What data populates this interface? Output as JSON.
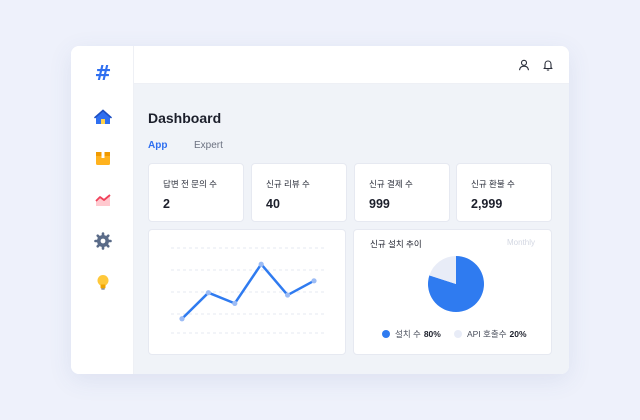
{
  "app": {
    "logo": "#"
  },
  "sidebar": {
    "items": [
      {
        "icon": "home-icon",
        "label": ""
      },
      {
        "icon": "box-icon",
        "label": ""
      },
      {
        "icon": "trend-chart-icon",
        "label": ""
      },
      {
        "icon": "gear-icon",
        "label": ""
      },
      {
        "icon": "lightbulb-icon",
        "label": ""
      }
    ]
  },
  "header": {
    "icons": [
      "user-icon",
      "bell-icon"
    ]
  },
  "main": {
    "title": "Dashboard",
    "tabs": [
      {
        "label": "App",
        "active": true
      },
      {
        "label": "Expert",
        "active": false
      }
    ],
    "stats": [
      {
        "label": "답변 전 문의 수",
        "value": "2"
      },
      {
        "label": "신규 리뷰 수",
        "value": "40"
      },
      {
        "label": "신규 결제 수",
        "value": "999"
      },
      {
        "label": "신규 환불 수",
        "value": "2,999"
      }
    ],
    "pie_panel": {
      "title": "신규 설치 추이",
      "subtitle": "Monthly",
      "legend": [
        {
          "label": "설치 수",
          "value": "80%",
          "color": "#2f7bf0"
        },
        {
          "label": "API 호출수",
          "value": "20%",
          "color": "#e8ecf7"
        }
      ]
    }
  },
  "colors": {
    "accent": "#2f6ff0",
    "line": "#2f7bf0",
    "pie_main": "#2f7bf0",
    "pie_rest": "#e8ecf7"
  },
  "chart_data": [
    {
      "type": "line",
      "x": [
        1,
        2,
        3,
        4,
        5,
        6
      ],
      "series": [
        {
          "values": [
            12,
            34,
            25,
            58,
            32,
            44
          ]
        }
      ],
      "ylim": [
        0,
        70
      ],
      "grid": true
    },
    {
      "type": "pie",
      "categories": [
        "설치 수",
        "API 호출수"
      ],
      "values": [
        80,
        20
      ]
    }
  ]
}
